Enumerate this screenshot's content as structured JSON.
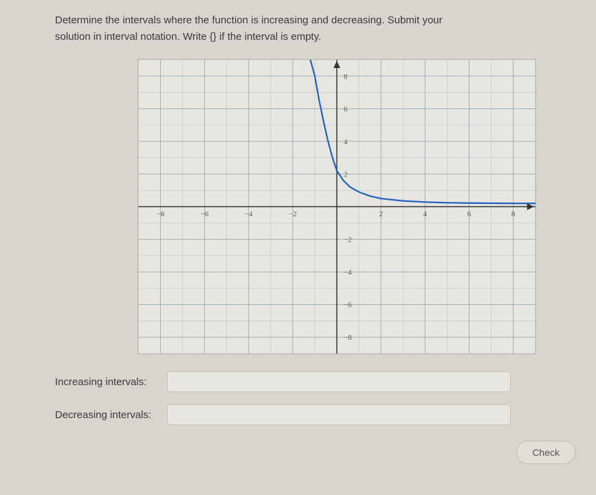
{
  "question": {
    "line1": "Determine the intervals where the function is increasing and decreasing. Submit your",
    "line2": "solution in interval notation. Write {} if the interval is empty."
  },
  "labels": {
    "increasing": "Increasing intervals:",
    "decreasing": "Decreasing intervals:"
  },
  "inputs": {
    "increasing_value": "",
    "decreasing_value": ""
  },
  "buttons": {
    "check": "Check"
  },
  "chart_data": {
    "type": "line",
    "title": "",
    "xlabel": "",
    "ylabel": "",
    "xlim": [
      -9,
      9
    ],
    "ylim": [
      -9,
      9
    ],
    "x_ticks": [
      -8,
      -6,
      -4,
      -2,
      2,
      4,
      6,
      8
    ],
    "y_ticks": [
      -8,
      -6,
      -4,
      -2,
      2,
      4,
      6,
      8
    ],
    "grid": true,
    "series": [
      {
        "name": "curve",
        "color": "#2060c0",
        "x": [
          -1.2,
          -1,
          -0.8,
          -0.6,
          -0.4,
          -0.2,
          0,
          0.3,
          0.6,
          1,
          1.5,
          2,
          3,
          4,
          5,
          6,
          7,
          8,
          9
        ],
        "y": [
          9,
          8,
          6.5,
          5.2,
          4,
          3,
          2.2,
          1.6,
          1.2,
          0.9,
          0.65,
          0.5,
          0.35,
          0.28,
          0.24,
          0.22,
          0.21,
          0.2,
          0.2
        ]
      }
    ]
  }
}
